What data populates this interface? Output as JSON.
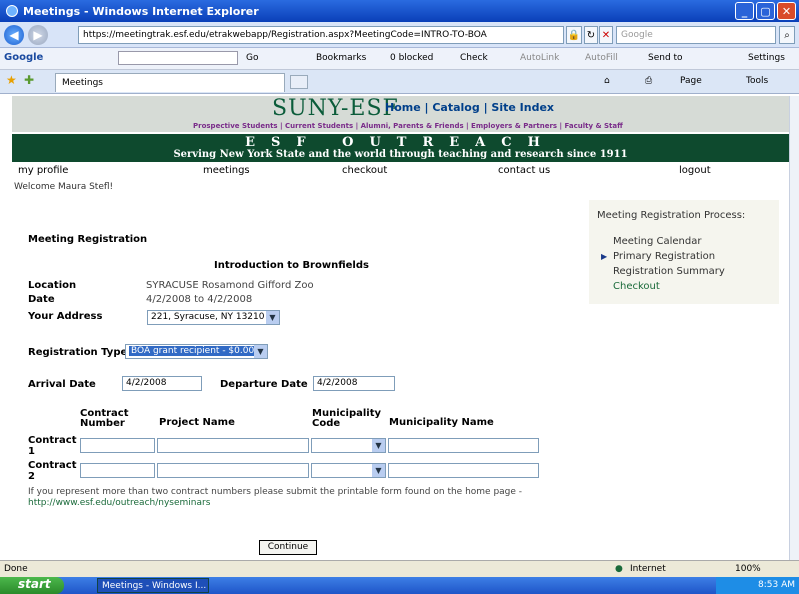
{
  "window": {
    "title": "Meetings - Windows Internet Explorer"
  },
  "browser": {
    "url": "https://meetingtrak.esf.edu/etrakwebapp/Registration.aspx?MeetingCode=INTRO-TO-BOA",
    "search_placeholder": "Google",
    "google_label": "Google",
    "go_label": "Go",
    "bookmarks_label": "Bookmarks",
    "blocked_label": "0 blocked",
    "check_label": "Check",
    "autolink_label": "AutoLink",
    "autofill_label": "AutoFill",
    "sendto_label": "Send to",
    "settings_label": "Settings",
    "tab_label": "Meetings",
    "page_label": "Page",
    "tools_label": "Tools"
  },
  "site": {
    "title": "SUNY-ESF",
    "header_links": "Home | Catalog | Site Index",
    "sub_links": "Prospective Students  |  Current Students  |  Alumni, Parents & Friends  |  Employers & Partners  |  Faculty & Staff",
    "outreach_title": "ESF OUTREACH",
    "tagline": "Serving New York State and the world through teaching and research since 1911"
  },
  "nav": {
    "profile": "my profile",
    "meetings": "meetings",
    "checkout": "checkout",
    "contact": "contact us",
    "logout": "logout"
  },
  "welcome": "Welcome Maura Stefl!",
  "form": {
    "heading": "Meeting Registration",
    "meeting_title": "Introduction to Brownfields",
    "location_label": "Location",
    "location_value": "SYRACUSE Rosamond Gifford Zoo",
    "date_label": "Date",
    "date_value": "4/2/2008 to 4/2/2008",
    "address_label": "Your Address",
    "address_value": "221, Syracuse, NY 13210",
    "reg_type_label": "Registration Type",
    "reg_type_value": "BOA grant recipient - $0.00",
    "arrival_label": "Arrival Date",
    "arrival_value": "4/2/2008",
    "departure_label": "Departure Date",
    "departure_value": "4/2/2008",
    "col_contract": "Contract Number",
    "col_project": "Project Name",
    "col_muni_code": "Municipality Code",
    "col_muni_name": "Municipality Name",
    "row1": "Contract 1",
    "row2": "Contract 2",
    "note": "If you represent more than two contract numbers please submit the printable form found on the home page - ",
    "note_link": "http://www.esf.edu/outreach/nyseminars",
    "continue": "Continue"
  },
  "sidebar": {
    "title": "Meeting Registration Process:",
    "items": [
      "Meeting Calendar",
      "Primary Registration",
      "Registration Summary",
      "Checkout"
    ]
  },
  "status": {
    "left": "Done",
    "zone": "Internet",
    "zoom": "100%"
  },
  "taskbar": {
    "start": "start",
    "task": "Meetings - Windows I...",
    "time": "8:53 AM"
  },
  "colors": {
    "brand_green": "#0e4a2e",
    "link_green": "#1a6a3a"
  }
}
